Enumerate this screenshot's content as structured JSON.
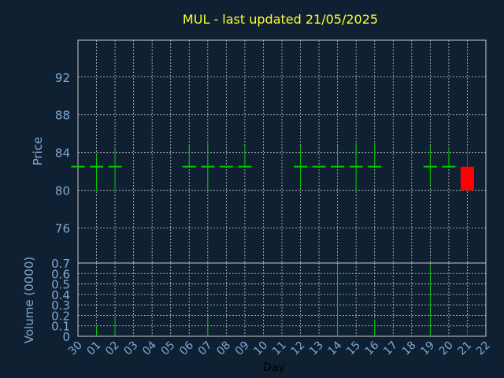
{
  "chart_data": {
    "type": "candlestick",
    "title": "MUL - last updated 21/05/2025",
    "xlabel": "Day",
    "x_ticks": [
      "30",
      "01",
      "02",
      "03",
      "04",
      "05",
      "06",
      "07",
      "08",
      "09",
      "10",
      "11",
      "12",
      "13",
      "14",
      "15",
      "16",
      "17",
      "18",
      "19",
      "20",
      "21",
      "22"
    ],
    "price_panel": {
      "ylabel": "Price",
      "ylim": [
        72.3,
        95.9
      ],
      "yticks": [
        76,
        80,
        84,
        88,
        92
      ],
      "grid": true
    },
    "volume_panel": {
      "ylabel": "Volume (0000)",
      "ylim": [
        0,
        0.7
      ],
      "yticks": [
        0,
        0.1,
        0.2,
        0.3,
        0.4,
        0.5,
        0.6,
        0.7
      ],
      "grid": true
    },
    "candles": [
      {
        "day": 0,
        "open": 82.5,
        "high": 82.5,
        "low": 82.5,
        "close": 82.5,
        "volume": 0
      },
      {
        "day": 1,
        "open": 82.5,
        "high": 83.8,
        "low": 80.0,
        "close": 82.5,
        "volume": 0.1
      },
      {
        "day": 2,
        "open": 82.5,
        "high": 84.5,
        "low": 80.0,
        "close": 82.5,
        "volume": 0.17
      },
      {
        "day": 6,
        "open": 82.5,
        "high": 84.8,
        "low": 82.5,
        "close": 82.5,
        "volume": 0
      },
      {
        "day": 7,
        "open": 82.5,
        "high": 85.0,
        "low": 80.0,
        "close": 82.5,
        "volume": 0.2
      },
      {
        "day": 8,
        "open": 82.5,
        "high": 82.5,
        "low": 82.5,
        "close": 82.5,
        "volume": 0
      },
      {
        "day": 9,
        "open": 82.5,
        "high": 84.7,
        "low": 82.5,
        "close": 82.5,
        "volume": 0
      },
      {
        "day": 12,
        "open": 82.5,
        "high": 84.8,
        "low": 80.2,
        "close": 82.5,
        "volume": 0
      },
      {
        "day": 13,
        "open": 82.5,
        "high": 82.5,
        "low": 82.5,
        "close": 82.5,
        "volume": 0
      },
      {
        "day": 14,
        "open": 82.5,
        "high": 84.8,
        "low": 82.5,
        "close": 82.5,
        "volume": 0.68
      },
      {
        "day": 15,
        "open": 82.5,
        "high": 85.0,
        "low": 80.0,
        "close": 82.5,
        "volume": 0
      },
      {
        "day": 16,
        "open": 82.5,
        "high": 85.0,
        "low": 82.5,
        "close": 82.5,
        "volume": 0.16
      },
      {
        "day": 19,
        "open": 82.5,
        "high": 84.8,
        "low": 80.5,
        "close": 82.5,
        "volume": 0.68
      },
      {
        "day": 20,
        "open": 82.5,
        "high": 84.5,
        "low": 82.5,
        "close": 82.5,
        "volume": 0
      },
      {
        "day": 21,
        "open": 82.5,
        "high": 84.5,
        "low": 80.0,
        "close": 80.0,
        "volume": 0.07
      }
    ],
    "colors": {
      "background": "#0f2033",
      "grid": "#c8c8c8",
      "axis_text": "#7fa8d0",
      "title": "#ffff33",
      "up": "#00cc00",
      "down": "#ff0000"
    }
  }
}
